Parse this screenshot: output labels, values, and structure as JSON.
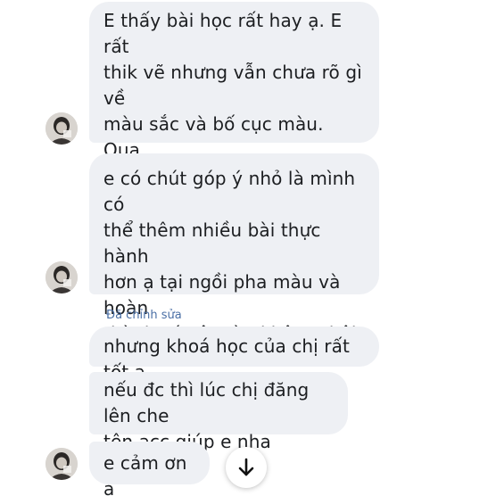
{
  "messages": [
    {
      "text": "E thấy bài học rất hay ạ. E rất\nthik vẽ nhưng vẫn chưa rõ gì về\nmàu sắc và bố cục màu. Qua\nkhoá học  em đã bt và hiểu hơn\nnhiều r ạ."
    },
    {
      "text": "e có chút góp ý nhỏ là mình có\nthể thêm nhiều bài thực hành\nhơn ạ tại ngồi pha màu và  hoàn\nthành các ô màu không thôi thì\ncó chút chán ạ"
    },
    {
      "text": "nhưng khoá học của chị rất tốt ạ"
    },
    {
      "text": "nếu đc thì lúc chị đăng lên  che\ntên acc giúp e nha"
    },
    {
      "text": "e cảm ơn ạ"
    }
  ],
  "edited_label": "Đã chỉnh sửa",
  "icons": {
    "avatar": "avatar-photo",
    "scroll": "arrow-down-icon"
  },
  "colors": {
    "bubble": "#eef0f4",
    "edited": "#4a6fa5"
  }
}
